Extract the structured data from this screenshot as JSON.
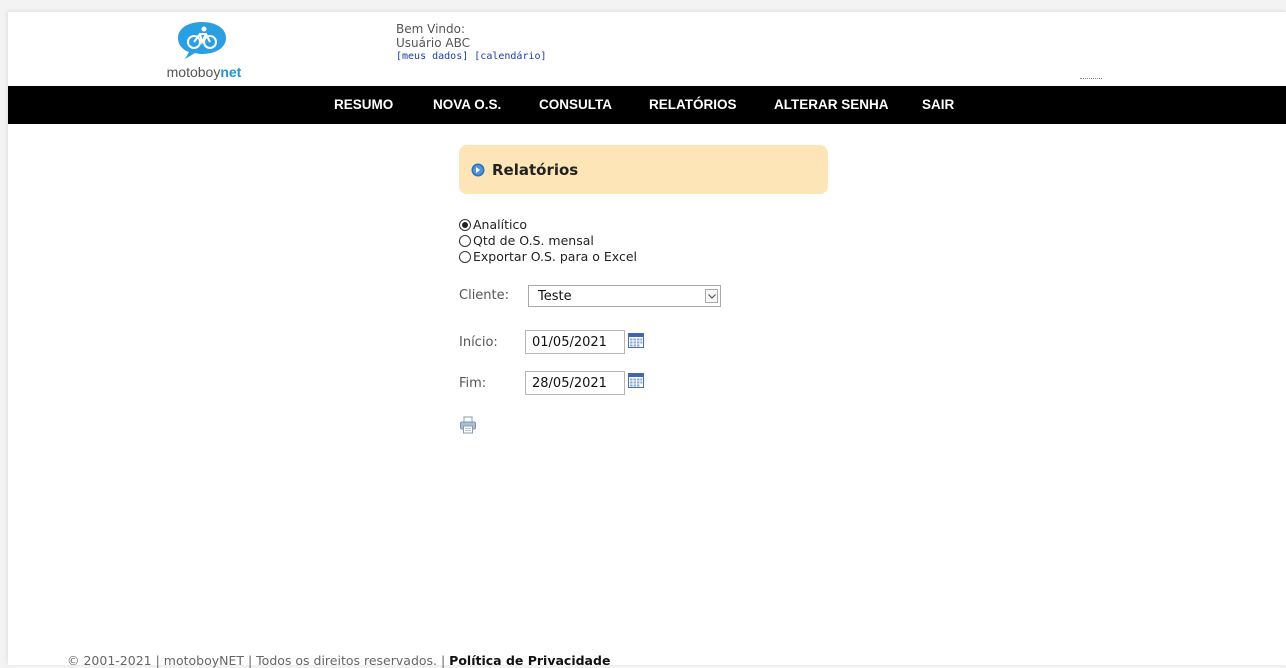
{
  "header": {
    "logo_text_main": "motoboy",
    "logo_text_accent": "net",
    "welcome_line": "Bem Vindo:",
    "user_name": "Usuário ABC",
    "link_meus_dados": "[meus dados]",
    "link_calendario": "[calendário]"
  },
  "nav": {
    "items": [
      {
        "label": "RESUMO"
      },
      {
        "label": "NOVA O.S."
      },
      {
        "label": "CONSULTA"
      },
      {
        "label": "RELATÓRIOS"
      },
      {
        "label": "ALTERAR SENHA"
      },
      {
        "label": "SAIR"
      }
    ]
  },
  "panel": {
    "title": "Relatórios",
    "icon": "circle-arrow-icon"
  },
  "report_options": [
    {
      "label": "Analítico",
      "checked": true
    },
    {
      "label": "Qtd de O.S. mensal",
      "checked": false
    },
    {
      "label": "Exportar O.S. para o Excel",
      "checked": false
    }
  ],
  "form": {
    "cliente_label": "Cliente:",
    "cliente_value": "Teste",
    "inicio_label": "Início:",
    "inicio_value": "01/05/2021",
    "fim_label": "Fim:",
    "fim_value": "28/05/2021"
  },
  "footer": {
    "copyright": "© 2001-2021 | motoboyNET | Todos os direitos reservados. | ",
    "policy_link": "Política de Privacidade"
  },
  "colors": {
    "nav_bg": "#000000",
    "panel_bg": "#fde5b7",
    "brand_blue": "#1f95d8",
    "link_blue": "#1b3da8"
  }
}
